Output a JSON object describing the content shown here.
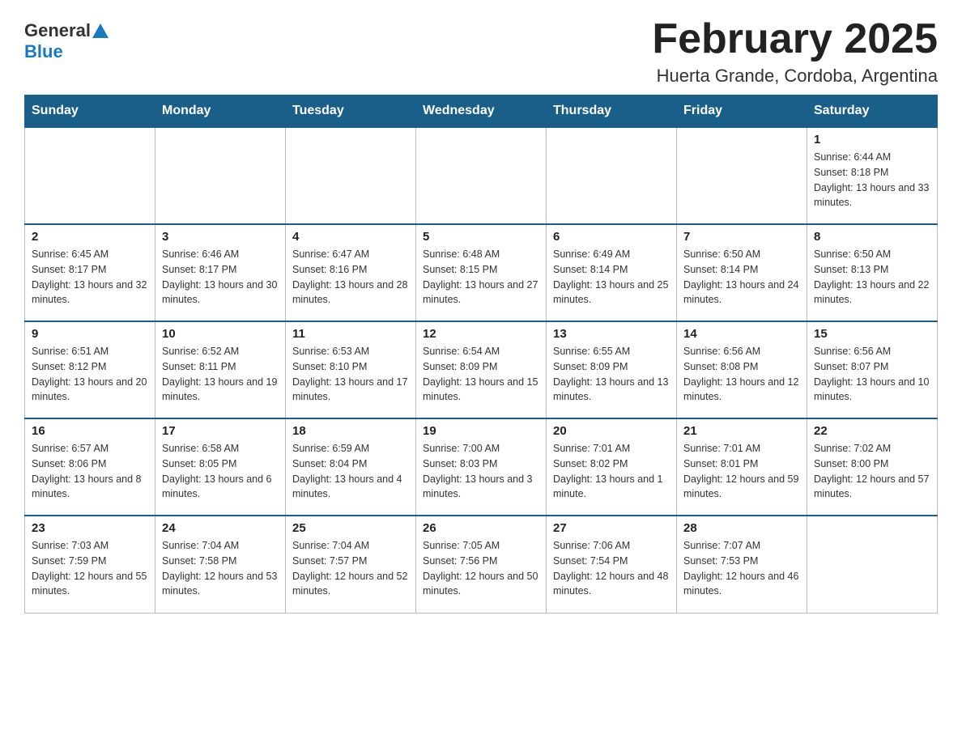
{
  "header": {
    "logo_general": "General",
    "logo_blue": "Blue",
    "title": "February 2025",
    "subtitle": "Huerta Grande, Cordoba, Argentina"
  },
  "days_of_week": [
    "Sunday",
    "Monday",
    "Tuesday",
    "Wednesday",
    "Thursday",
    "Friday",
    "Saturday"
  ],
  "weeks": [
    {
      "days": [
        {
          "number": "",
          "info": ""
        },
        {
          "number": "",
          "info": ""
        },
        {
          "number": "",
          "info": ""
        },
        {
          "number": "",
          "info": ""
        },
        {
          "number": "",
          "info": ""
        },
        {
          "number": "",
          "info": ""
        },
        {
          "number": "1",
          "info": "Sunrise: 6:44 AM\nSunset: 8:18 PM\nDaylight: 13 hours and 33 minutes."
        }
      ]
    },
    {
      "days": [
        {
          "number": "2",
          "info": "Sunrise: 6:45 AM\nSunset: 8:17 PM\nDaylight: 13 hours and 32 minutes."
        },
        {
          "number": "3",
          "info": "Sunrise: 6:46 AM\nSunset: 8:17 PM\nDaylight: 13 hours and 30 minutes."
        },
        {
          "number": "4",
          "info": "Sunrise: 6:47 AM\nSunset: 8:16 PM\nDaylight: 13 hours and 28 minutes."
        },
        {
          "number": "5",
          "info": "Sunrise: 6:48 AM\nSunset: 8:15 PM\nDaylight: 13 hours and 27 minutes."
        },
        {
          "number": "6",
          "info": "Sunrise: 6:49 AM\nSunset: 8:14 PM\nDaylight: 13 hours and 25 minutes."
        },
        {
          "number": "7",
          "info": "Sunrise: 6:50 AM\nSunset: 8:14 PM\nDaylight: 13 hours and 24 minutes."
        },
        {
          "number": "8",
          "info": "Sunrise: 6:50 AM\nSunset: 8:13 PM\nDaylight: 13 hours and 22 minutes."
        }
      ]
    },
    {
      "days": [
        {
          "number": "9",
          "info": "Sunrise: 6:51 AM\nSunset: 8:12 PM\nDaylight: 13 hours and 20 minutes."
        },
        {
          "number": "10",
          "info": "Sunrise: 6:52 AM\nSunset: 8:11 PM\nDaylight: 13 hours and 19 minutes."
        },
        {
          "number": "11",
          "info": "Sunrise: 6:53 AM\nSunset: 8:10 PM\nDaylight: 13 hours and 17 minutes."
        },
        {
          "number": "12",
          "info": "Sunrise: 6:54 AM\nSunset: 8:09 PM\nDaylight: 13 hours and 15 minutes."
        },
        {
          "number": "13",
          "info": "Sunrise: 6:55 AM\nSunset: 8:09 PM\nDaylight: 13 hours and 13 minutes."
        },
        {
          "number": "14",
          "info": "Sunrise: 6:56 AM\nSunset: 8:08 PM\nDaylight: 13 hours and 12 minutes."
        },
        {
          "number": "15",
          "info": "Sunrise: 6:56 AM\nSunset: 8:07 PM\nDaylight: 13 hours and 10 minutes."
        }
      ]
    },
    {
      "days": [
        {
          "number": "16",
          "info": "Sunrise: 6:57 AM\nSunset: 8:06 PM\nDaylight: 13 hours and 8 minutes."
        },
        {
          "number": "17",
          "info": "Sunrise: 6:58 AM\nSunset: 8:05 PM\nDaylight: 13 hours and 6 minutes."
        },
        {
          "number": "18",
          "info": "Sunrise: 6:59 AM\nSunset: 8:04 PM\nDaylight: 13 hours and 4 minutes."
        },
        {
          "number": "19",
          "info": "Sunrise: 7:00 AM\nSunset: 8:03 PM\nDaylight: 13 hours and 3 minutes."
        },
        {
          "number": "20",
          "info": "Sunrise: 7:01 AM\nSunset: 8:02 PM\nDaylight: 13 hours and 1 minute."
        },
        {
          "number": "21",
          "info": "Sunrise: 7:01 AM\nSunset: 8:01 PM\nDaylight: 12 hours and 59 minutes."
        },
        {
          "number": "22",
          "info": "Sunrise: 7:02 AM\nSunset: 8:00 PM\nDaylight: 12 hours and 57 minutes."
        }
      ]
    },
    {
      "days": [
        {
          "number": "23",
          "info": "Sunrise: 7:03 AM\nSunset: 7:59 PM\nDaylight: 12 hours and 55 minutes."
        },
        {
          "number": "24",
          "info": "Sunrise: 7:04 AM\nSunset: 7:58 PM\nDaylight: 12 hours and 53 minutes."
        },
        {
          "number": "25",
          "info": "Sunrise: 7:04 AM\nSunset: 7:57 PM\nDaylight: 12 hours and 52 minutes."
        },
        {
          "number": "26",
          "info": "Sunrise: 7:05 AM\nSunset: 7:56 PM\nDaylight: 12 hours and 50 minutes."
        },
        {
          "number": "27",
          "info": "Sunrise: 7:06 AM\nSunset: 7:54 PM\nDaylight: 12 hours and 48 minutes."
        },
        {
          "number": "28",
          "info": "Sunrise: 7:07 AM\nSunset: 7:53 PM\nDaylight: 12 hours and 46 minutes."
        },
        {
          "number": "",
          "info": ""
        }
      ]
    }
  ]
}
